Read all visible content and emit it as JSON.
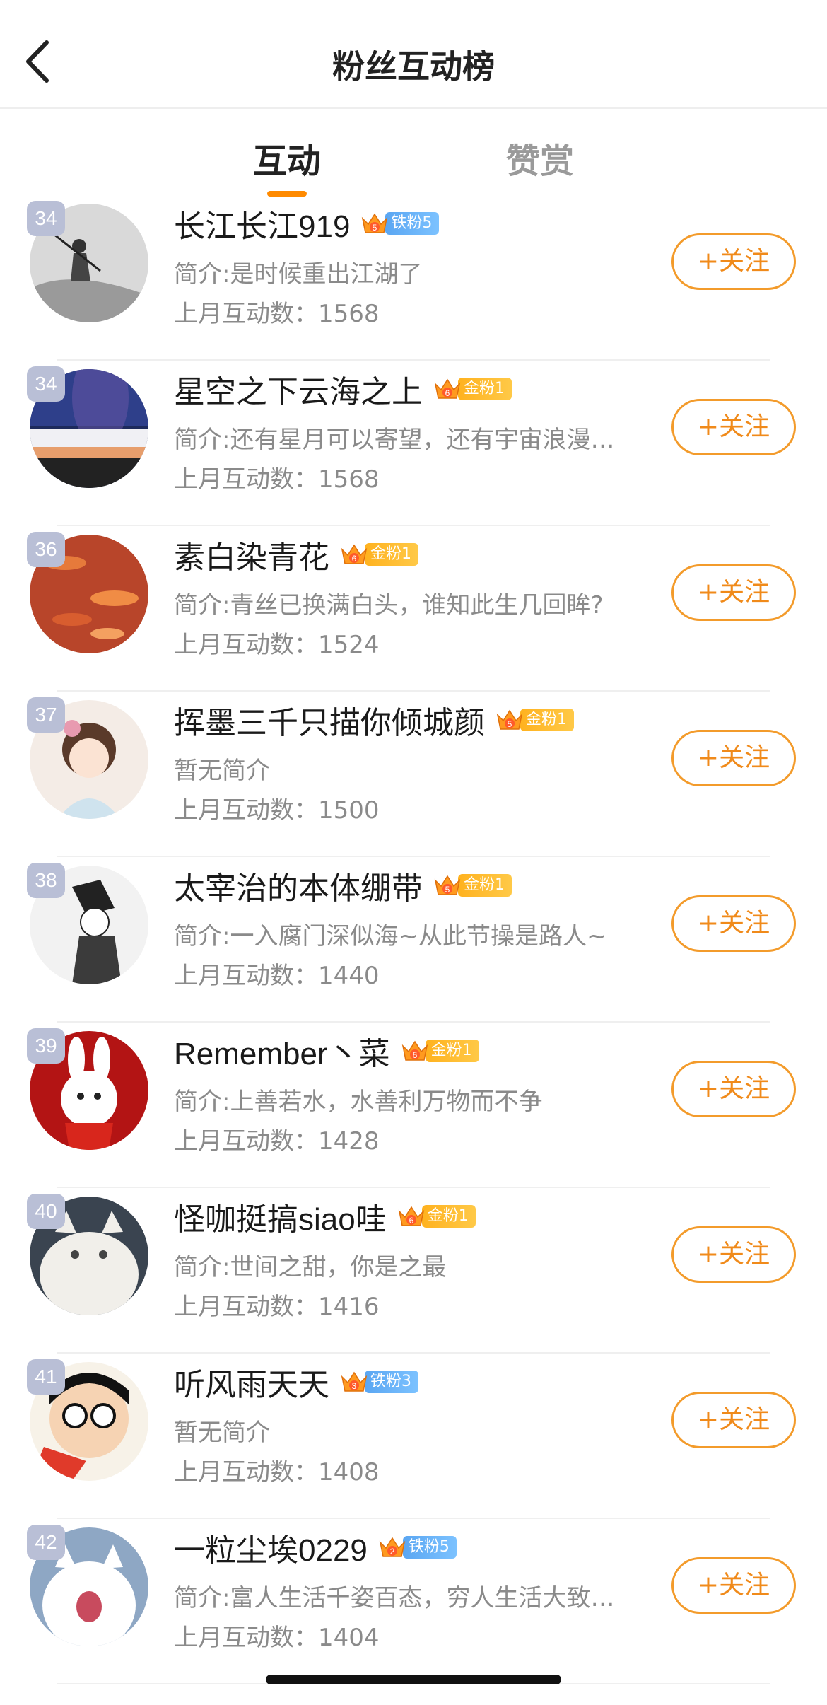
{
  "header": {
    "title": "粉丝互动榜"
  },
  "tabs": [
    {
      "label": "互动",
      "active": true
    },
    {
      "label": "赞赏",
      "active": false
    }
  ],
  "colors": {
    "accent": "#ff8a00",
    "follow_text": "#f08a1a",
    "rank_bg": "#b9bfd6",
    "gold_badge": "#ffb21f",
    "iron_badge": "#5aa6f2"
  },
  "follow_label": "+关注",
  "users": [
    {
      "rank": "34",
      "name": "长江长江919",
      "badge_level": "5",
      "badge_type": "iron",
      "badge_label": "铁粉5",
      "bio": "简介:是时候重出江湖了",
      "count": "上月互动数：1568",
      "avatar_icon": "ink-painting-fisherman-avatar"
    },
    {
      "rank": "34",
      "name": "星空之下云海之上",
      "badge_level": "6",
      "badge_type": "gold",
      "badge_label": "金粉1",
      "bio": "简介:还有星月可以寄望，还有宇宙浪漫…",
      "count": "上月互动数：1568",
      "avatar_icon": "starry-sky-avatar"
    },
    {
      "rank": "36",
      "name": "素白染青花",
      "badge_level": "6",
      "badge_type": "gold",
      "badge_label": "金粉1",
      "bio": "简介:青丝已换满白头，谁知此生几回眸?",
      "count": "上月互动数：1524",
      "avatar_icon": "koi-fish-avatar"
    },
    {
      "rank": "37",
      "name": "挥墨三千只描你倾城颜",
      "badge_level": "5",
      "badge_type": "gold",
      "badge_label": "金粉1",
      "bio": "暂无简介",
      "count": "上月互动数：1500",
      "avatar_icon": "anime-girl-avatar"
    },
    {
      "rank": "38",
      "name": "太宰治的本体绷带",
      "badge_level": "5",
      "badge_type": "gold",
      "badge_label": "金粉1",
      "bio": "简介:一入腐门深似海~从此节操是路人~",
      "count": "上月互动数：1440",
      "avatar_icon": "manga-boy-avatar"
    },
    {
      "rank": "39",
      "name": "Remember丶菜",
      "badge_level": "6",
      "badge_type": "gold",
      "badge_label": "金粉1",
      "bio": "简介:上善若水，水善利万物而不争",
      "count": "上月互动数：1428",
      "avatar_icon": "rabbit-avatar"
    },
    {
      "rank": "40",
      "name": "怪咖挺搞siao哇",
      "badge_level": "6",
      "badge_type": "gold",
      "badge_label": "金粉1",
      "bio": "简介:世间之甜，你是之最",
      "count": "上月互动数：1416",
      "avatar_icon": "white-cat-avatar"
    },
    {
      "rank": "41",
      "name": "听风雨天天",
      "badge_level": "3",
      "badge_type": "iron",
      "badge_label": "铁粉3",
      "bio": "暂无简介",
      "count": "上月互动数：1408",
      "avatar_icon": "crayon-shin-chan-avatar"
    },
    {
      "rank": "42",
      "name": "一粒尘埃0229",
      "badge_level": "2",
      "badge_type": "iron",
      "badge_label": "铁粉5",
      "bio": "简介:富人生活千姿百态，穷人生活大致…",
      "count": "上月互动数：1404",
      "avatar_icon": "yawning-cat-avatar"
    }
  ]
}
